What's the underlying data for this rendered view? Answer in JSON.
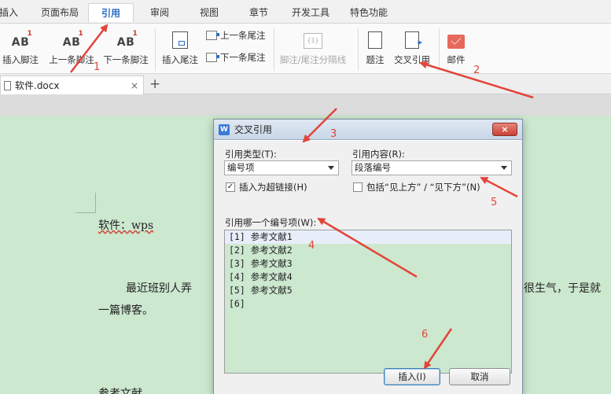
{
  "ribbon_tabs": [
    "插入",
    "页面布局",
    "引用",
    "审阅",
    "视图",
    "章节",
    "开发工具",
    "特色功能"
  ],
  "ribbon": {
    "insert_footnote": "插入脚注",
    "prev_footnote": "上一条脚注",
    "next_footnote": "下一条脚注",
    "insert_endnote": "插入尾注",
    "prev_endnote": "上一条尾注",
    "next_endnote": "下一条尾注",
    "separator_line": "脚注/尾注分隔线",
    "caption": "题注",
    "cross_reference": "交叉引用",
    "mail": "邮件",
    "footnote_badge": "1",
    "footnote_glyph": "AB"
  },
  "document_tab": {
    "name": "软件.docx",
    "close": "×",
    "new": "+"
  },
  "document": {
    "line1": "软件：wps",
    "line2_left": "最近班别人弄",
    "line2_right": "很生气，于是就",
    "line3": "一篇博客。",
    "line4": "参考文献"
  },
  "dialog": {
    "title": "交叉引用",
    "close": "×",
    "reference_type_label": "引用类型(T):",
    "reference_type_value": "编号项",
    "reference_content_label": "引用内容(R):",
    "reference_content_value": "段落编号",
    "insert_hyperlink_label": "插入为超链接(H)",
    "insert_hyperlink_checked": true,
    "include_above_below_label": "包括“见上方” / “见下方”(N)",
    "include_above_below_checked": false,
    "list_label": "引用哪一个编号项(W):",
    "items": [
      "[1] 参考文献1",
      "[2] 参考文献2",
      "[3] 参考文献3",
      "[4] 参考文献4",
      "[5] 参考文献5",
      "[6]"
    ],
    "selected_index": 0,
    "insert_button": "插入(I)",
    "cancel_button": "取消"
  },
  "annotations": [
    "1",
    "2",
    "3",
    "4",
    "5",
    "6"
  ],
  "colors": {
    "accent": "#2b6cc4",
    "annotation": "#e2453a",
    "page": "#cce8cf"
  }
}
